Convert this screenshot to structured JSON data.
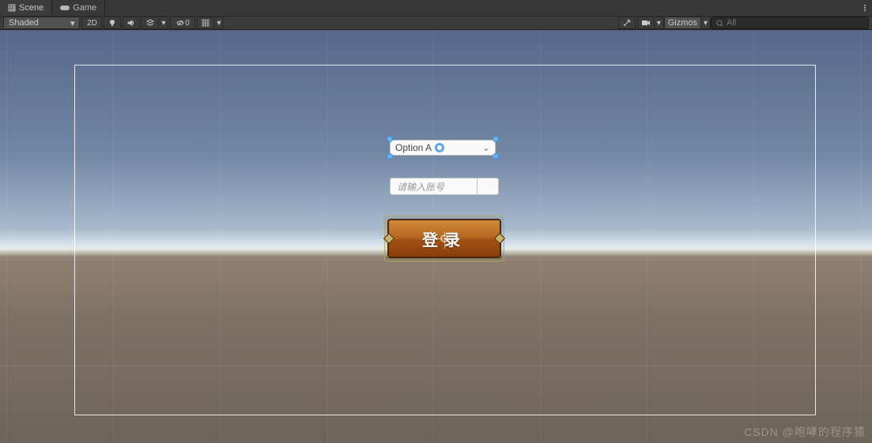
{
  "tabs": {
    "scene": "Scene",
    "game": "Game"
  },
  "toolbar": {
    "shading_mode": "Shaded",
    "view_2d": "2D",
    "hidden_count": "0",
    "gizmos": "Gizmos",
    "search_placeholder": "All"
  },
  "canvas": {
    "dropdown_value": "Option A",
    "input_placeholder": "请输入账号",
    "login_label": "登录"
  },
  "watermark": "CSDN @咆哮的程序猿"
}
